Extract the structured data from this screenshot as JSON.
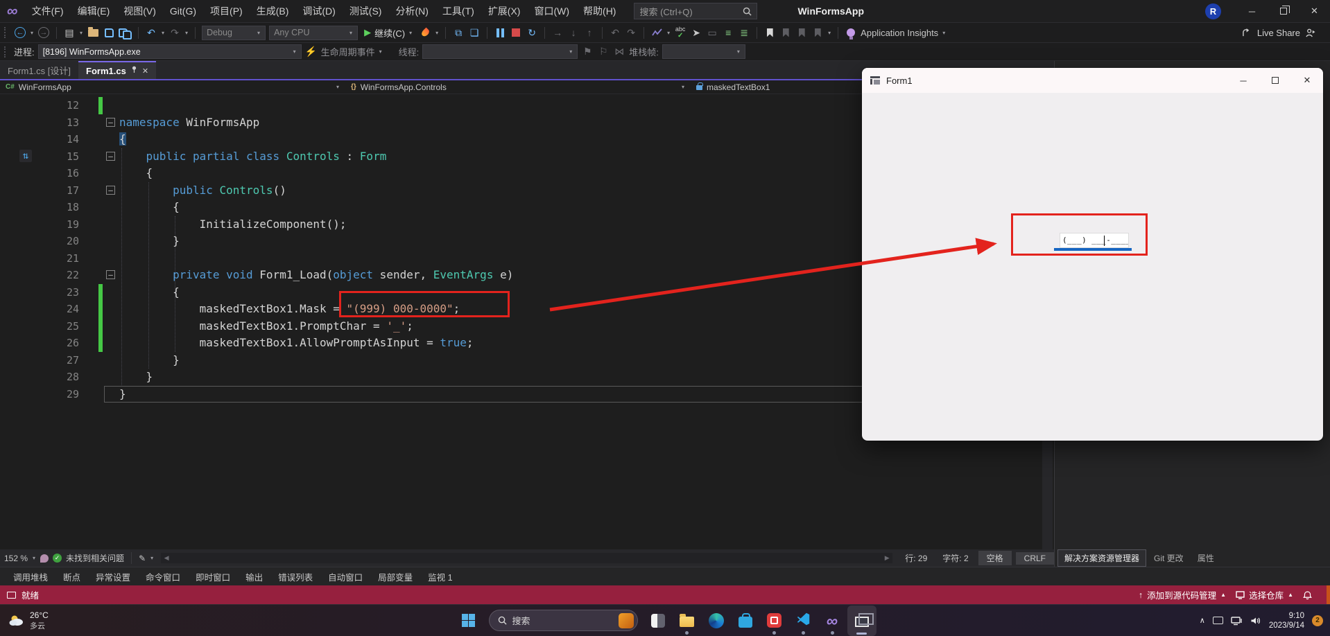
{
  "titlebar": {
    "menus": [
      "文件(F)",
      "编辑(E)",
      "视图(V)",
      "Git(G)",
      "项目(P)",
      "生成(B)",
      "调试(D)",
      "测试(S)",
      "分析(N)",
      "工具(T)",
      "扩展(X)",
      "窗口(W)",
      "帮助(H)"
    ],
    "search_placeholder": "搜索 (Ctrl+Q)",
    "solution_name": "WinFormsApp",
    "account_initial": "R"
  },
  "toolbar": {
    "config": "Debug",
    "platform": "Any CPU",
    "continue_label": "继续(C)",
    "app_insights": "Application Insights",
    "live_share": "Live Share"
  },
  "debug_bar": {
    "process_label": "进程:",
    "process_value": "[8196] WinFormsApp.exe",
    "lifecycle_label": "生命周期事件",
    "thread_label": "线程:",
    "stack_label": "堆栈帧:"
  },
  "tabs": [
    {
      "label": "Form1.cs [设计]",
      "active": false
    },
    {
      "label": "Form1.cs",
      "active": true
    }
  ],
  "breadcrumb": {
    "project": "WinFormsApp",
    "type": "WinFormsApp.Controls",
    "member": "maskedTextBox1"
  },
  "editor": {
    "lines": [
      {
        "n": 12,
        "chg": true,
        "tokens": []
      },
      {
        "n": 13,
        "fold": true,
        "tokens": [
          [
            "k",
            "namespace"
          ],
          [
            "p",
            " WinFormsApp"
          ]
        ]
      },
      {
        "n": 14,
        "tokens": [
          [
            "sel",
            "{"
          ]
        ]
      },
      {
        "n": 15,
        "fold": true,
        "glyph": true,
        "tokens": [
          [
            "p",
            "    "
          ],
          [
            "k",
            "public partial class"
          ],
          [
            "p",
            " "
          ],
          [
            "t",
            "Controls"
          ],
          [
            "p",
            " : "
          ],
          [
            "t",
            "Form"
          ]
        ]
      },
      {
        "n": 16,
        "tokens": [
          [
            "p",
            "    {"
          ]
        ]
      },
      {
        "n": 17,
        "fold": true,
        "tokens": [
          [
            "p",
            "        "
          ],
          [
            "k",
            "public"
          ],
          [
            "p",
            " "
          ],
          [
            "t",
            "Controls"
          ],
          [
            "p",
            "()"
          ]
        ]
      },
      {
        "n": 18,
        "tokens": [
          [
            "p",
            "        {"
          ]
        ]
      },
      {
        "n": 19,
        "tokens": [
          [
            "p",
            "            InitializeComponent();"
          ]
        ]
      },
      {
        "n": 20,
        "tokens": [
          [
            "p",
            "        }"
          ]
        ]
      },
      {
        "n": 21,
        "tokens": []
      },
      {
        "n": 22,
        "fold": true,
        "tokens": [
          [
            "p",
            "        "
          ],
          [
            "k",
            "private void"
          ],
          [
            "p",
            " Form1_Load("
          ],
          [
            "k",
            "object"
          ],
          [
            "p",
            " sender, "
          ],
          [
            "t",
            "EventArgs"
          ],
          [
            "p",
            " e)"
          ]
        ]
      },
      {
        "n": 23,
        "chg": true,
        "tokens": [
          [
            "p",
            "        {"
          ]
        ]
      },
      {
        "n": 24,
        "chg": true,
        "tokens": [
          [
            "p",
            "            maskedTextBox1.Mask = "
          ],
          [
            "s",
            "\"(999) 000-0000\""
          ],
          [
            "p",
            ";"
          ]
        ]
      },
      {
        "n": 25,
        "chg": true,
        "tokens": [
          [
            "p",
            "            maskedTextBox1.PromptChar = "
          ],
          [
            "s",
            "'_'"
          ],
          [
            "p",
            ";"
          ]
        ]
      },
      {
        "n": 26,
        "chg": true,
        "tokens": [
          [
            "p",
            "            maskedTextBox1.AllowPromptAsInput = "
          ],
          [
            "k",
            "true"
          ],
          [
            "p",
            ";"
          ]
        ]
      },
      {
        "n": 27,
        "tokens": [
          [
            "p",
            "        }"
          ]
        ]
      },
      {
        "n": 28,
        "tokens": [
          [
            "p",
            "    }"
          ]
        ]
      },
      {
        "n": 29,
        "cur": true,
        "tokens": [
          [
            "p",
            "}"
          ]
        ]
      }
    ]
  },
  "editor_status": {
    "zoom": "152 %",
    "message": "未找到相关问题",
    "line": "行: 29",
    "column": "字符: 2",
    "spaces": "空格",
    "eol": "CRLF"
  },
  "right_panel": {
    "tabs": [
      "解决方案资源管理器",
      "Git 更改",
      "属性"
    ],
    "active_index": 0
  },
  "bottom_tabs": [
    "调用堆栈",
    "断点",
    "异常设置",
    "命令窗口",
    "即时窗口",
    "输出",
    "错误列表",
    "自动窗口",
    "局部变量",
    "监视 1"
  ],
  "status_bar": {
    "ready": "就绪",
    "add_to_source": "添加到源代码管理",
    "select_repo": "选择仓库"
  },
  "form_window": {
    "title": "Form1",
    "masked_text": "(___) ___-____"
  },
  "taskbar": {
    "temp": "26°C",
    "weather": "多云",
    "search_label": "搜索",
    "time": "9:10",
    "date": "2023/9/14",
    "badge": "2",
    "apps": [
      {
        "name": "task-view",
        "running": false
      },
      {
        "name": "file-explorer",
        "running": true
      },
      {
        "name": "edge",
        "running": false
      },
      {
        "name": "microsoft-store",
        "running": false
      },
      {
        "name": "red-media-app",
        "running": true
      },
      {
        "name": "vs-code",
        "running": true
      },
      {
        "name": "visual-studio",
        "running": true
      },
      {
        "name": "window-switcher",
        "running": true,
        "active": true
      }
    ]
  },
  "colors": {
    "annotation_red": "#e3231d",
    "keyword_blue": "#569cd6",
    "type_teal": "#4ec9b0",
    "string_salmon": "#d69d85",
    "change_green": "#45c845",
    "status_crimson": "#96203e",
    "accent_purple": "#6152ce"
  }
}
